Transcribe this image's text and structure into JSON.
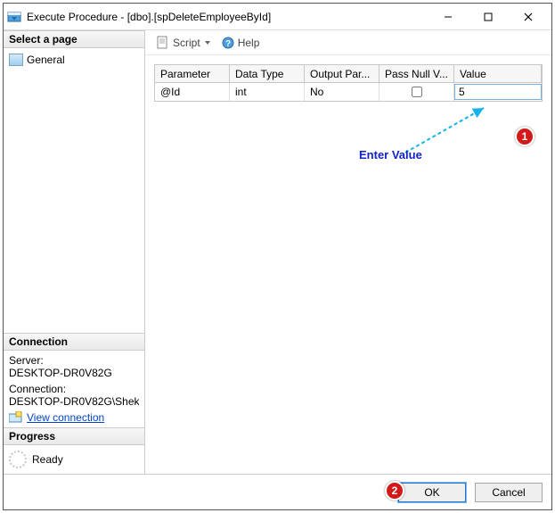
{
  "window": {
    "title": "Execute Procedure - [dbo].[spDeleteEmployeeById]"
  },
  "sidebar": {
    "select_page_header": "Select a page",
    "pages": [
      {
        "label": "General"
      }
    ],
    "connection_header": "Connection",
    "server_label": "Server:",
    "server_value": "DESKTOP-DR0V82G",
    "connection_label": "Connection:",
    "connection_value": "DESKTOP-DR0V82G\\Shek",
    "view_connection_label": "View connection ",
    "progress_header": "Progress",
    "progress_status": "Ready"
  },
  "toolbar": {
    "script_label": "Script",
    "help_label": "Help"
  },
  "grid": {
    "headers": {
      "parameter": "Parameter",
      "data_type": "Data Type",
      "output": "Output Par...",
      "pass_null": "Pass Null V...",
      "value": "Value"
    },
    "row": {
      "parameter": "@Id",
      "data_type": "int",
      "output": "No",
      "pass_null": false,
      "value": "5"
    }
  },
  "footer": {
    "ok": "OK",
    "cancel": "Cancel"
  },
  "annotations": {
    "enter_value": "Enter Value",
    "callout1": "1",
    "callout2": "2"
  }
}
